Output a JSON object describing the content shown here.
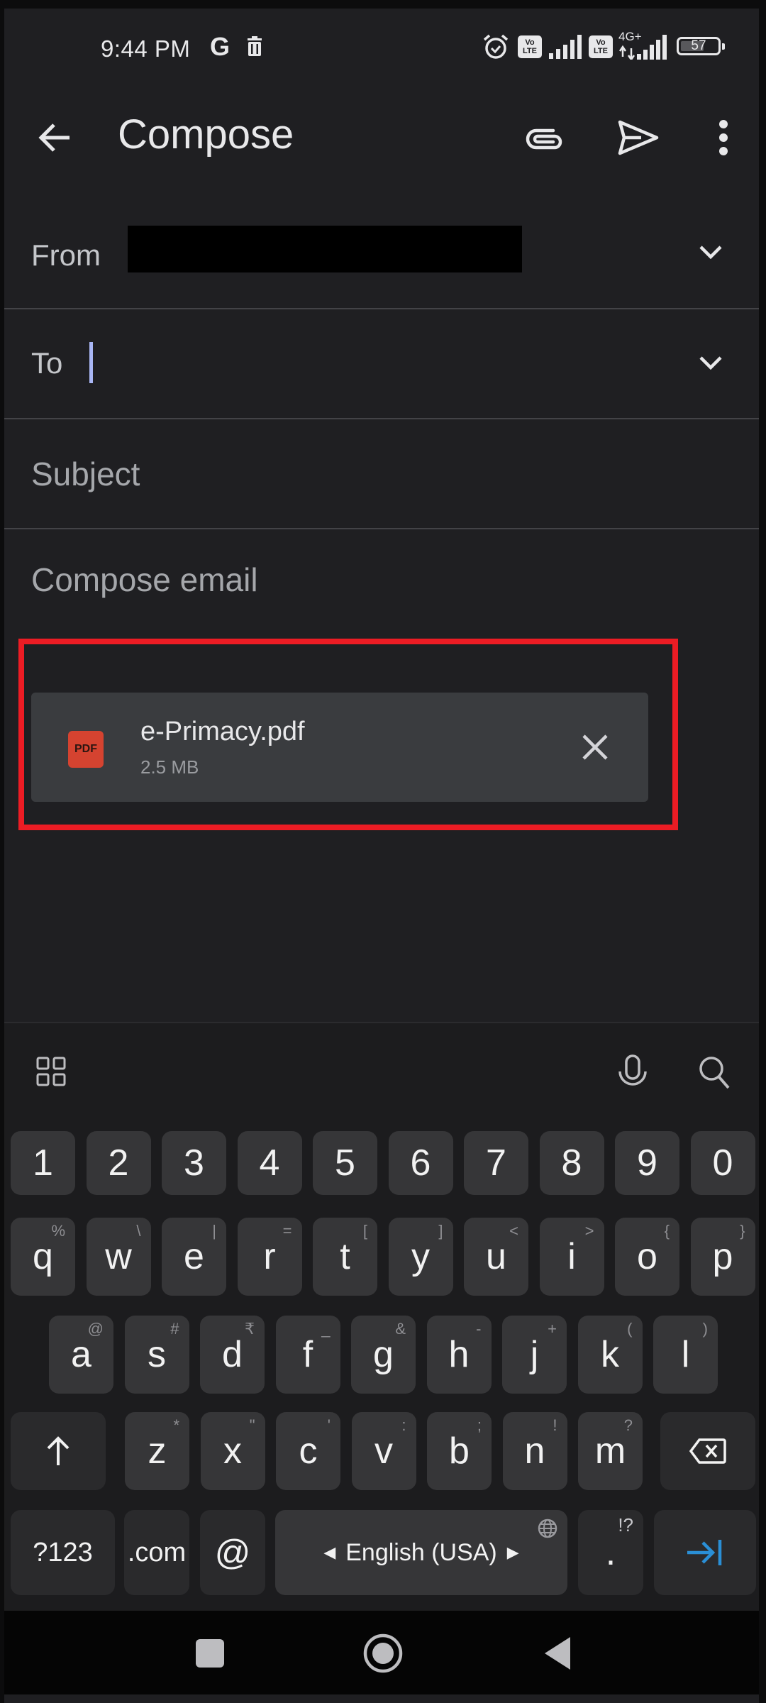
{
  "status_bar": {
    "time": "9:44 PM",
    "notif_icons": [
      "google-g-icon",
      "trash-icon"
    ],
    "system_icons": [
      "alarm-icon",
      "volte-icon",
      "signal-icon",
      "volte-icon",
      "4g-signal-icon"
    ],
    "volte_label_top": "Vo",
    "volte_label_bottom": "LTE",
    "network_type": "4G+",
    "battery": "57"
  },
  "app_bar": {
    "title": "Compose",
    "back_icon": "arrow-left-icon",
    "actions": [
      "attach-icon",
      "send-icon",
      "more-vert-icon"
    ]
  },
  "fields": {
    "from_label": "From",
    "to_label": "To",
    "to_value": "",
    "subject_placeholder": "Subject",
    "body_placeholder": "Compose email"
  },
  "attachment": {
    "type_label": "PDF",
    "name": "e-Primacy.pdf",
    "size": "2.5 MB",
    "accent_color": "#d54330",
    "highlight_color": "#ec1c24"
  },
  "keyboard": {
    "toolbar": [
      "apps-grid-icon",
      "mic-icon",
      "search-icon"
    ],
    "number_row": [
      "1",
      "2",
      "3",
      "4",
      "5",
      "6",
      "7",
      "8",
      "9",
      "0"
    ],
    "row1": [
      {
        "k": "q",
        "h": "%"
      },
      {
        "k": "w",
        "h": "\\"
      },
      {
        "k": "e",
        "h": "|"
      },
      {
        "k": "r",
        "h": "="
      },
      {
        "k": "t",
        "h": "["
      },
      {
        "k": "y",
        "h": "]"
      },
      {
        "k": "u",
        "h": "<"
      },
      {
        "k": "i",
        "h": ">"
      },
      {
        "k": "o",
        "h": "{"
      },
      {
        "k": "p",
        "h": "}"
      }
    ],
    "row2": [
      {
        "k": "a",
        "h": "@"
      },
      {
        "k": "s",
        "h": "#"
      },
      {
        "k": "d",
        "h": "₹"
      },
      {
        "k": "f",
        "h": "_"
      },
      {
        "k": "g",
        "h": "&"
      },
      {
        "k": "h",
        "h": "-"
      },
      {
        "k": "j",
        "h": "+"
      },
      {
        "k": "k",
        "h": "("
      },
      {
        "k": "l",
        "h": ")"
      }
    ],
    "row3": [
      {
        "k": "z",
        "h": "*"
      },
      {
        "k": "x",
        "h": "\""
      },
      {
        "k": "c",
        "h": "'"
      },
      {
        "k": "v",
        "h": ":"
      },
      {
        "k": "b",
        "h": ";"
      },
      {
        "k": "n",
        "h": "!"
      },
      {
        "k": "m",
        "h": "?"
      }
    ],
    "symbols_label": "?123",
    "dotcom_label": ".com",
    "at_label": "@",
    "space_label": "English (USA)",
    "period_label": ".",
    "period_hint": "!?",
    "enter_color": "#2a8fd6"
  },
  "nav_bar": [
    "recents-square-icon",
    "home-circle-icon",
    "back-triangle-icon"
  ]
}
